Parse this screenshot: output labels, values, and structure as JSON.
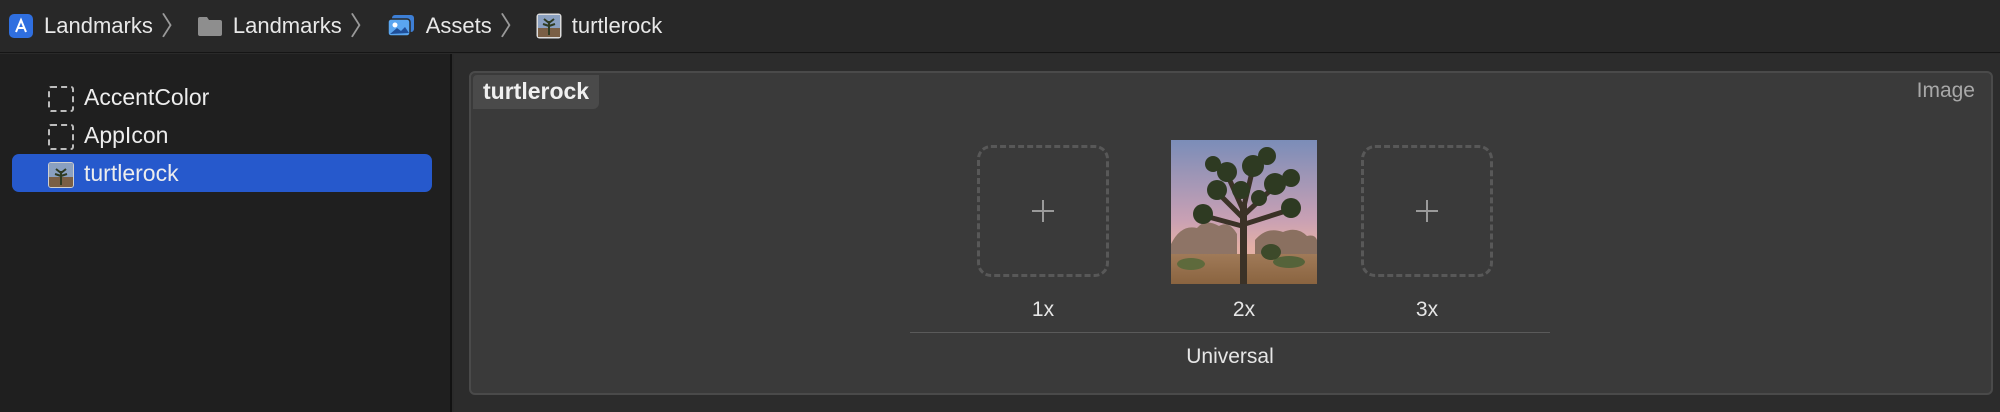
{
  "breadcrumb": {
    "items": [
      {
        "label": "Landmarks",
        "icon": "xcode-project-icon"
      },
      {
        "label": "Landmarks",
        "icon": "folder-icon"
      },
      {
        "label": "Assets",
        "icon": "asset-catalog-icon"
      },
      {
        "label": "turtlerock",
        "icon": "image-set-icon"
      }
    ],
    "separator": "〉"
  },
  "sidebar": {
    "items": [
      {
        "label": "AccentColor",
        "icon": "color-set-icon",
        "selected": false
      },
      {
        "label": "AppIcon",
        "icon": "app-icon-set-icon",
        "selected": false
      },
      {
        "label": "turtlerock",
        "icon": "image-set-icon",
        "selected": true
      }
    ]
  },
  "image_set": {
    "name": "turtlerock",
    "type_label": "Image",
    "slots": [
      {
        "scale": "1x",
        "filled": false
      },
      {
        "scale": "2x",
        "filled": true
      },
      {
        "scale": "3x",
        "filled": false
      }
    ],
    "idiom": "Universal"
  },
  "colors": {
    "selection": "#2659cc",
    "sidebar_bg": "#1f1f1f",
    "panel_bg": "#3a3a3a"
  }
}
